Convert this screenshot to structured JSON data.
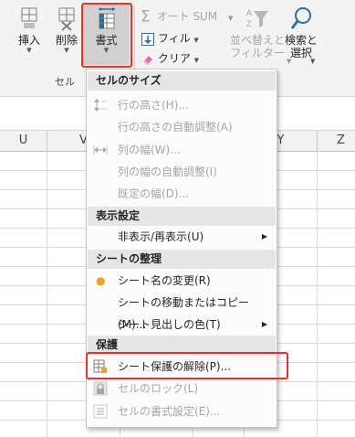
{
  "ribbon": {
    "insert_label": "挿入",
    "delete_label": "削除",
    "format_label": "書式",
    "autosum_label": "オート SUM",
    "fill_label": "フィル",
    "clear_label": "クリア",
    "sort_filter_label_1": "並べ替えと",
    "sort_filter_label_2": "フィルター",
    "find_select_label_1": "検索と",
    "find_select_label_2": "選択",
    "cells_group_label": "セル"
  },
  "columns": [
    "U",
    "V",
    "W",
    "X",
    "Y",
    "Z"
  ],
  "menu": {
    "cell_size_header": "セルのサイズ",
    "row_height": "行の高さ(H)...",
    "autofit_row_height": "行の高さの自動調整(A)",
    "column_width": "列の幅(W)...",
    "autofit_column_width": "列の幅の自動調整(I)",
    "default_width": "既定の幅(D)...",
    "visibility_header": "表示設定",
    "hide_unhide": "非表示/再表示(U)",
    "organize_sheets_header": "シートの整理",
    "rename_sheet": "シート名の変更(R)",
    "move_copy_sheet": "シートの移動またはコピー(M)...",
    "tab_color": "シート見出しの色(T)",
    "protection_header": "保護",
    "unprotect_sheet": "シート保護の解除(P)...",
    "lock_cell": "セルのロック(L)",
    "format_cells": "セルの書式設定(E)..."
  },
  "colors": {
    "highlight_red": "#e8332a",
    "accent_blue": "#2b6cb0",
    "bullet_orange": "#f0a030"
  }
}
